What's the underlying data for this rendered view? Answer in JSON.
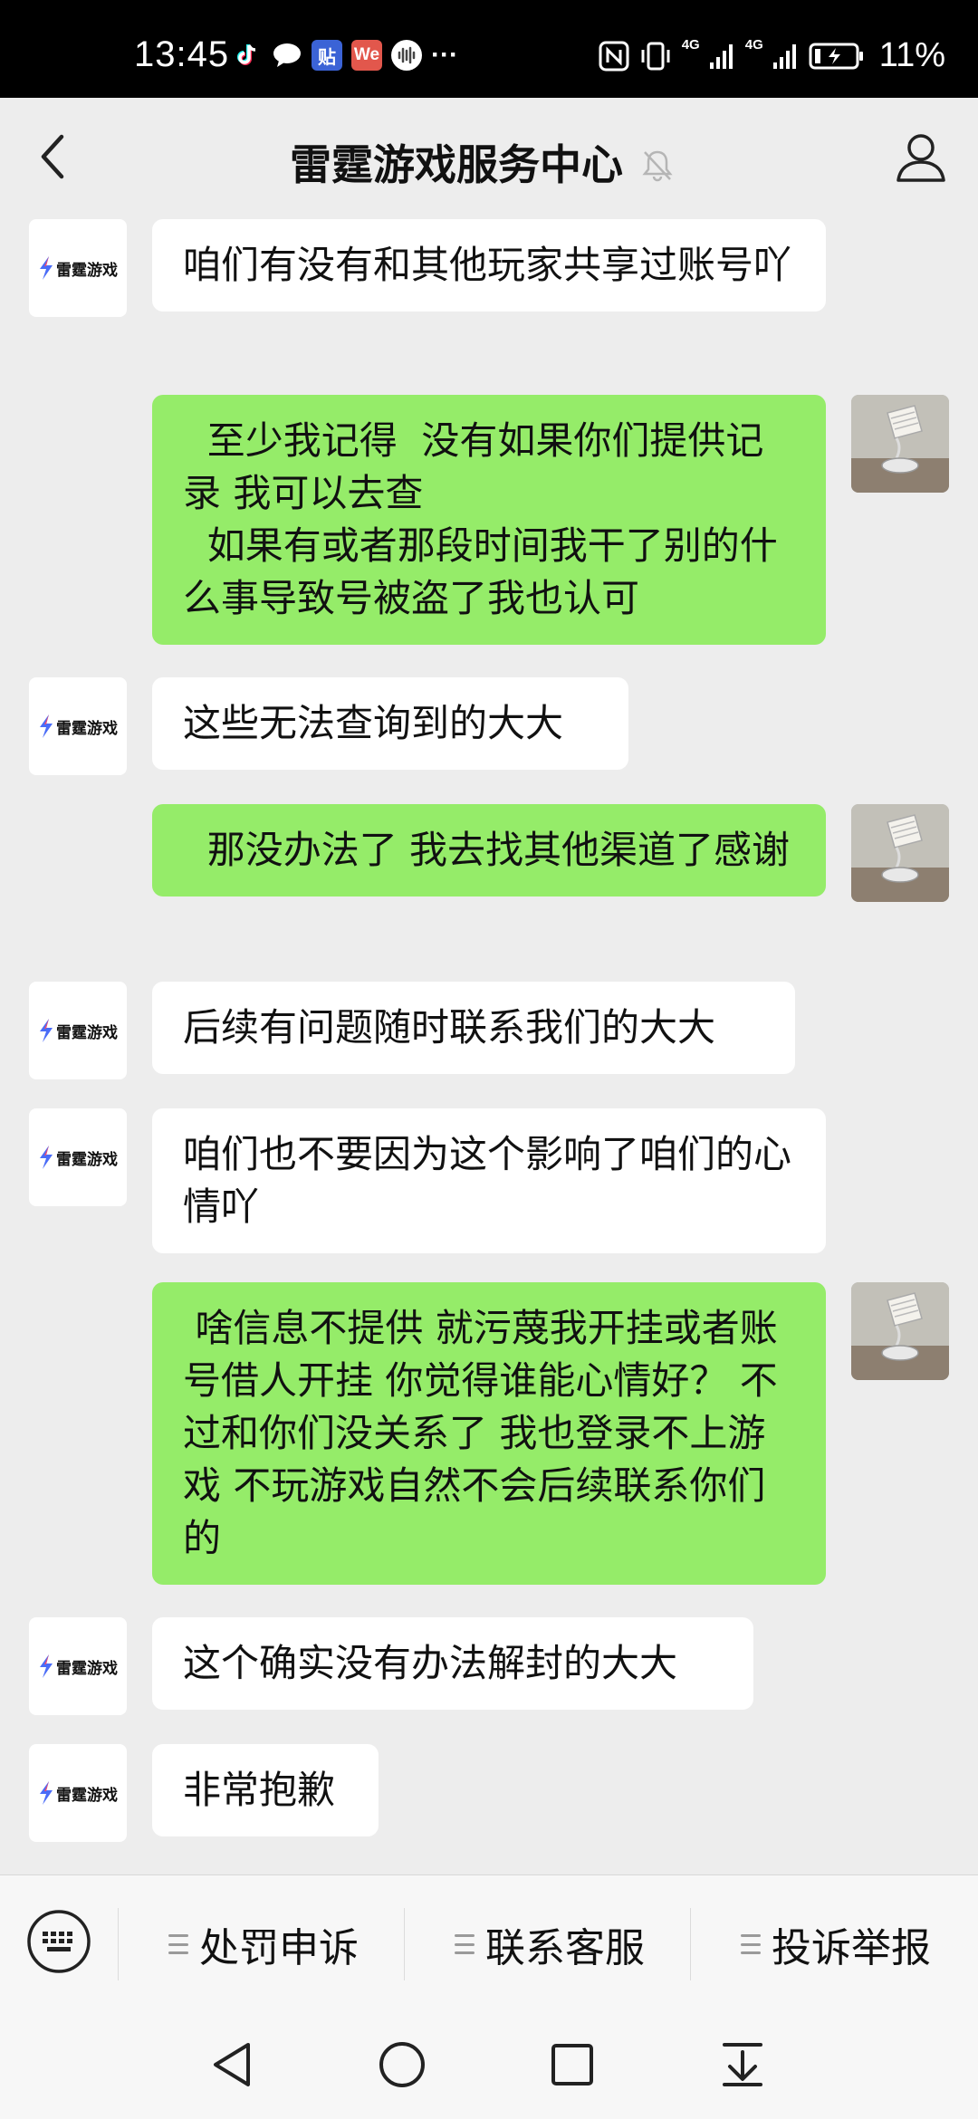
{
  "status_bar": {
    "time": "13:45",
    "tie_badge": "贴",
    "we_badge": "We",
    "more": "···",
    "net1": "4G",
    "net2": "4G",
    "battery": "11%"
  },
  "header": {
    "title": "雷霆游戏服务中心"
  },
  "service_logo_text": "雷霆游戏",
  "messages": [
    {
      "side": "in",
      "text": "咱们有没有和其他玩家共享过账号吖"
    },
    {
      "side": "out",
      "text": "  至少我记得  没有如果你们提供记录 我可以去查\n  如果有或者那段时间我干了别的什么事导致号被盗了我也认可"
    },
    {
      "side": "in",
      "text": "这些无法查询到的大大"
    },
    {
      "side": "out",
      "text": "  那没办法了 我去找其他渠道了感谢"
    },
    {
      "side": "in",
      "text": "后续有问题随时联系我们的大大"
    },
    {
      "side": "in",
      "text": "咱们也不要因为这个影响了咱们的心情吖"
    },
    {
      "side": "out",
      "text": " 啥信息不提供 就污蔑我开挂或者账号借人开挂 你觉得谁能心情好？ 不过和你们没关系了 我也登录不上游戏 不玩游戏自然不会后续联系你们的"
    },
    {
      "side": "in",
      "text": "这个确实没有办法解封的大大"
    },
    {
      "side": "in",
      "text": "非常抱歉"
    }
  ],
  "menu": {
    "items": [
      {
        "label": "处罚申诉"
      },
      {
        "label": "联系客服"
      },
      {
        "label": "投诉举报"
      }
    ]
  }
}
